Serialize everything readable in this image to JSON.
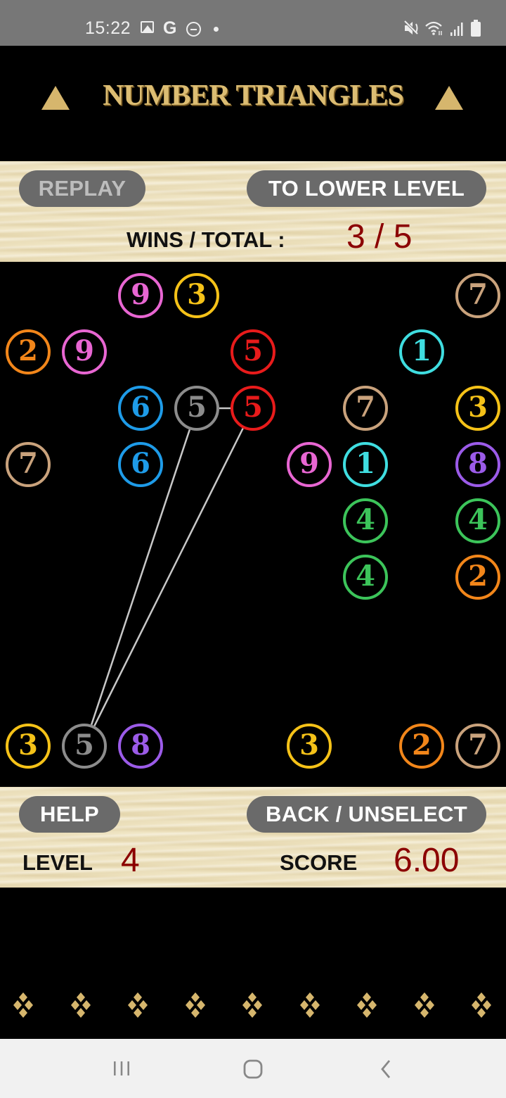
{
  "status_bar": {
    "time": "15:22",
    "left_icons": [
      "gallery-icon",
      "google-icon",
      "do-not-disturb-icon",
      "notification-dot-icon"
    ],
    "google_glyph": "G",
    "right_icons": [
      "mute-icon",
      "wifi-icon",
      "signal-icon",
      "battery-icon"
    ],
    "mute_glyph": "🔇"
  },
  "header": {
    "title": "NUMBER TRIANGLES",
    "title_color": "#dcbd73"
  },
  "top_panel": {
    "replay_label": "REPLAY",
    "replay_enabled": false,
    "lower_level_label": "TO LOWER LEVEL",
    "wins_total_label": "WINS / TOTAL :",
    "wins_total_value": "3 / 5"
  },
  "board": {
    "columns": 9,
    "tiles": [
      {
        "col": 2,
        "row": 0,
        "value": "9",
        "color": "#e866d2"
      },
      {
        "col": 3,
        "row": 0,
        "value": "3",
        "color": "#f5c218"
      },
      {
        "col": 8,
        "row": 0,
        "value": "7",
        "color": "#c9a27c"
      },
      {
        "col": 0,
        "row": 1,
        "value": "2",
        "color": "#f2861a"
      },
      {
        "col": 1,
        "row": 1,
        "value": "9",
        "color": "#e866d2"
      },
      {
        "col": 4,
        "row": 1,
        "value": "5",
        "color": "#e81b1b"
      },
      {
        "col": 7,
        "row": 1,
        "value": "1",
        "color": "#3fdde0"
      },
      {
        "col": 2,
        "row": 2,
        "value": "6",
        "color": "#1e9be8"
      },
      {
        "col": 3,
        "row": 2,
        "value": "5",
        "color": "#8c8c8c",
        "selected": true
      },
      {
        "col": 4,
        "row": 2,
        "value": "5",
        "color": "#e81b1b"
      },
      {
        "col": 6,
        "row": 2,
        "value": "7",
        "color": "#c9a27c"
      },
      {
        "col": 8,
        "row": 2,
        "value": "3",
        "color": "#f5c218"
      },
      {
        "col": 0,
        "row": 3,
        "value": "7",
        "color": "#c9a27c"
      },
      {
        "col": 2,
        "row": 3,
        "value": "6",
        "color": "#1e9be8"
      },
      {
        "col": 5,
        "row": 3,
        "value": "9",
        "color": "#e866d2"
      },
      {
        "col": 6,
        "row": 3,
        "value": "1",
        "color": "#3fdde0"
      },
      {
        "col": 8,
        "row": 3,
        "value": "8",
        "color": "#9b5be8"
      },
      {
        "col": 6,
        "row": 4,
        "value": "4",
        "color": "#3cc45a"
      },
      {
        "col": 8,
        "row": 4,
        "value": "4",
        "color": "#3cc45a"
      },
      {
        "col": 6,
        "row": 5,
        "value": "4",
        "color": "#3cc45a"
      },
      {
        "col": 8,
        "row": 5,
        "value": "2",
        "color": "#f2861a"
      },
      {
        "col": 0,
        "row": 8,
        "value": "3",
        "color": "#f5c218"
      },
      {
        "col": 1,
        "row": 8,
        "value": "5",
        "color": "#8c8c8c",
        "selected": true
      },
      {
        "col": 2,
        "row": 8,
        "value": "8",
        "color": "#9b5be8"
      },
      {
        "col": 5,
        "row": 8,
        "value": "3",
        "color": "#f5c218"
      },
      {
        "col": 7,
        "row": 8,
        "value": "2",
        "color": "#f2861a"
      },
      {
        "col": 8,
        "row": 8,
        "value": "7",
        "color": "#c9a27c"
      }
    ],
    "connections": [
      {
        "from": [
          3,
          2
        ],
        "to": [
          4,
          2
        ]
      },
      {
        "from": [
          1,
          8
        ],
        "to": [
          3,
          2
        ]
      },
      {
        "from": [
          1,
          8
        ],
        "to": [
          4,
          2
        ]
      }
    ],
    "line_color": "#c8c8c8"
  },
  "bottom_panel": {
    "help_label": "HELP",
    "back_label": "BACK / UNSELECT",
    "level_label": "LEVEL",
    "level_value": "4",
    "score_label": "SCORE",
    "score_value": "6.00"
  },
  "decorations": {
    "count": 9,
    "icon": "diamond-cluster-icon",
    "color": "#d6b66d"
  },
  "nav_bar": {
    "buttons": [
      "recent-apps",
      "home",
      "back"
    ]
  }
}
